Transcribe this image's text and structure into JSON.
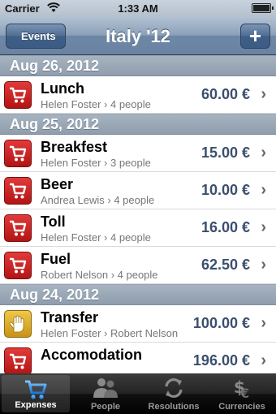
{
  "status_bar": {
    "carrier": "Carrier",
    "time": "1:33 AM"
  },
  "nav": {
    "title": "Italy '12",
    "back_label": "Events",
    "add_label": "+"
  },
  "sections": [
    {
      "header": "Aug 26, 2012",
      "rows": [
        {
          "title": "Lunch",
          "subtitle": "Helen Foster › 4 people",
          "amount": "60.00 €",
          "icon": "cart-icon"
        }
      ]
    },
    {
      "header": "Aug 25, 2012",
      "rows": [
        {
          "title": "Breakfest",
          "subtitle": "Helen Foster › 3 people",
          "amount": "15.00 €",
          "icon": "cart-icon"
        },
        {
          "title": "Beer",
          "subtitle": "Andrea Lewis › 4 people",
          "amount": "10.00 €",
          "icon": "cart-icon"
        },
        {
          "title": "Toll",
          "subtitle": "Helen Foster › 4 people",
          "amount": "16.00 €",
          "icon": "cart-icon"
        },
        {
          "title": "Fuel",
          "subtitle": "Robert Nelson › 4 people",
          "amount": "62.50 €",
          "icon": "cart-icon"
        }
      ]
    },
    {
      "header": "Aug 24, 2012",
      "rows": [
        {
          "title": "Transfer",
          "subtitle": "Helen Foster › Robert Nelson",
          "amount": "100.00 €",
          "icon": "hand-icon"
        },
        {
          "title": "Accomodation",
          "subtitle": "",
          "amount": "196.00 €",
          "icon": "cart-icon"
        }
      ]
    }
  ],
  "chevron": "›",
  "tabs": [
    {
      "label": "Expenses",
      "icon": "cart-icon",
      "active": true
    },
    {
      "label": "People",
      "icon": "people-icon",
      "active": false
    },
    {
      "label": "Resolutions",
      "icon": "arrows-icon",
      "active": false
    },
    {
      "label": "Currencies",
      "icon": "currency-icon",
      "active": false
    }
  ],
  "colors": {
    "accent": "#3a4f6e",
    "icon_red": "#c21e1e",
    "icon_gold": "#e0a92a",
    "tab_active": "#2a8be0"
  }
}
